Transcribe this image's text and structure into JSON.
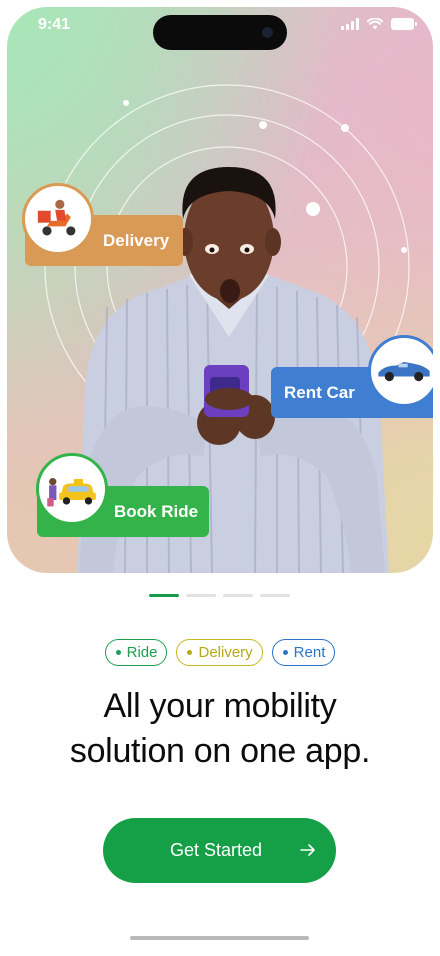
{
  "status_bar": {
    "time": "9:41"
  },
  "hero": {
    "chips": {
      "delivery": "Delivery",
      "rent": "Rent Car",
      "ride": "Book Ride"
    }
  },
  "pager": {
    "count": 4,
    "active": 0
  },
  "tags": {
    "ride": "Ride",
    "delivery": "Delivery",
    "rent": "Rent"
  },
  "headline": {
    "line1": "All your mobility",
    "line2": "solution on one app."
  },
  "cta": {
    "label": "Get Started",
    "icon": "arrow-right-icon"
  },
  "colors": {
    "brand_green": "#15a047",
    "delivery_orange": "#d99a55",
    "rent_blue": "#3f7ed0",
    "ride_green": "#33b34a"
  }
}
